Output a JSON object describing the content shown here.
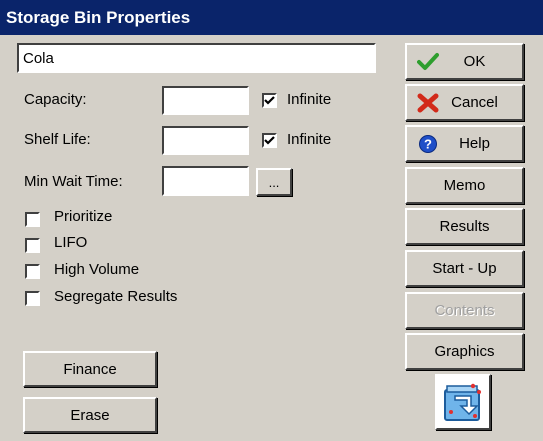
{
  "window": {
    "title": "Storage Bin Properties"
  },
  "name_field": {
    "value": "Cola"
  },
  "capacity": {
    "label": "Capacity:",
    "value": "",
    "infinite_label": "Infinite",
    "infinite_checked": true
  },
  "shelf_life": {
    "label": "Shelf Life:",
    "value": "",
    "infinite_label": "Infinite",
    "infinite_checked": true
  },
  "min_wait": {
    "label": "Min Wait Time:",
    "value": "",
    "browse_label": "..."
  },
  "options": [
    {
      "label": "Prioritize",
      "checked": false
    },
    {
      "label": "LIFO",
      "checked": false
    },
    {
      "label": "High Volume",
      "checked": false
    },
    {
      "label": "Segregate Results",
      "checked": false
    }
  ],
  "buttons": {
    "ok": "OK",
    "cancel": "Cancel",
    "help": "Help",
    "memo": "Memo",
    "results": "Results",
    "startup": "Start - Up",
    "contents": "Contents",
    "graphics": "Graphics",
    "finance": "Finance",
    "erase": "Erase"
  },
  "colors": {
    "titlebar": "#0a246a",
    "ok_check": "#2e9e2e",
    "cancel_x": "#d22a1a",
    "help_circle": "#1f4fc8"
  },
  "icons": {
    "ok": "check-icon",
    "cancel": "x-icon",
    "help": "help-icon",
    "graphic": "storage-bin-icon"
  }
}
